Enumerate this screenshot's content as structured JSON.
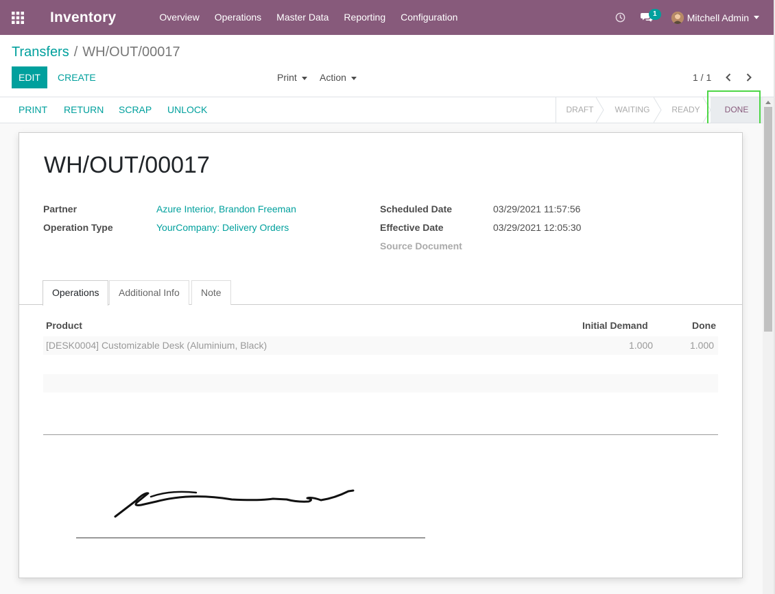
{
  "navbar": {
    "app_name": "Inventory",
    "menu": [
      "Overview",
      "Operations",
      "Master Data",
      "Reporting",
      "Configuration"
    ],
    "chat_badge": "1",
    "user_name": "Mitchell Admin"
  },
  "control": {
    "breadcrumb_parent": "Transfers",
    "breadcrumb_separator": "/",
    "breadcrumb_current": "WH/OUT/00017",
    "edit_label": "EDIT",
    "create_label": "CREATE",
    "print_label": "Print",
    "action_label": "Action",
    "pager": "1 / 1"
  },
  "statusbar": {
    "buttons": [
      "PRINT",
      "RETURN",
      "SCRAP",
      "UNLOCK"
    ],
    "stages": [
      "DRAFT",
      "WAITING",
      "READY",
      "DONE"
    ],
    "active_stage": "DONE"
  },
  "record": {
    "name": "WH/OUT/00017",
    "fields_left": [
      {
        "label": "Partner",
        "value": "Azure Interior, Brandon Freeman"
      },
      {
        "label": "Operation Type",
        "value": "YourCompany: Delivery Orders"
      }
    ],
    "fields_right": [
      {
        "label": "Scheduled Date",
        "value": "03/29/2021 11:57:56"
      },
      {
        "label": "Effective Date",
        "value": "03/29/2021 12:05:30"
      },
      {
        "label": "Source Document",
        "value": ""
      }
    ]
  },
  "tabs": [
    "Operations",
    "Additional Info",
    "Note"
  ],
  "operations_table": {
    "columns": [
      "Product",
      "Initial Demand",
      "Done"
    ],
    "rows": [
      {
        "product": "[DESK0004] Customizable Desk (Aluminium, Black)",
        "initial_demand": "1.000",
        "done": "1.000"
      }
    ]
  },
  "colors": {
    "brand": "#875a7b",
    "accent": "#00a09d",
    "highlight": "#4cd645"
  }
}
